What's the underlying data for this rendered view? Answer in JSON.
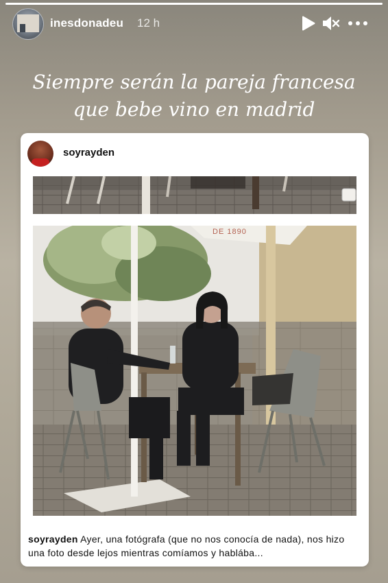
{
  "story": {
    "progress": 1.0,
    "username": "inesdonadeu",
    "time": "12 h",
    "text": "Siempre serán la pareja francesa que bebe vino en madrid",
    "icons": [
      "play-icon",
      "mute-icon",
      "more-icon"
    ]
  },
  "post": {
    "username": "soyrayden",
    "caption_user": "soyrayden",
    "caption_text": "Ayer, una fotógrafa (que no nos conocía de nada), nos hizo una foto desde lejos mientras comíamos y hablába...",
    "photo_sign_text": "DE 1890"
  },
  "colors": {
    "card_bg": "#ffffff",
    "text_dark": "#111111",
    "story_text": "#ffffff"
  }
}
